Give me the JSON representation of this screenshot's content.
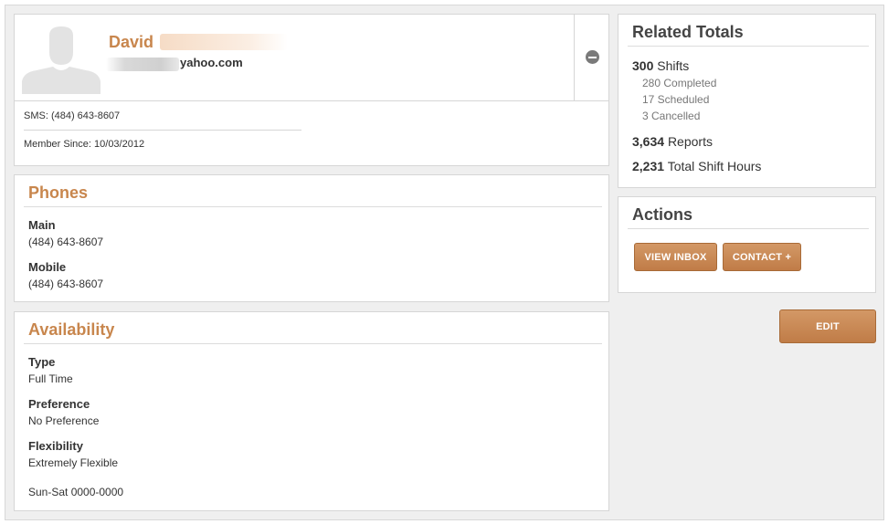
{
  "profile": {
    "first_name": "David",
    "email_visible": "yahoo.com",
    "sms": "SMS: (484) 643-8607",
    "member_since": "Member Since: 10/03/2012"
  },
  "phones": {
    "title": "Phones",
    "items": [
      {
        "label": "Main",
        "value": "(484) 643-8607"
      },
      {
        "label": "Mobile",
        "value": "(484) 643-8607"
      }
    ]
  },
  "availability": {
    "title": "Availability",
    "fields": [
      {
        "label": "Type",
        "value": "Full Time"
      },
      {
        "label": "Preference",
        "value": "No Preference"
      },
      {
        "label": "Flexibility",
        "value": "Extremely Flexible"
      }
    ],
    "schedule": "Sun-Sat 0000-0000"
  },
  "totals": {
    "title": "Related Totals",
    "shifts_count": "300",
    "shifts_label": "Shifts",
    "completed": "280 Completed",
    "scheduled": "17 Scheduled",
    "cancelled": "3 Cancelled",
    "reports_count": "3,634",
    "reports_label": "Reports",
    "hours_count": "2,231",
    "hours_label": "Total Shift Hours"
  },
  "actions": {
    "title": "Actions",
    "view_inbox": "VIEW INBOX",
    "contact": "CONTACT +",
    "edit": "EDIT"
  },
  "colors": {
    "accent": "#c8864d",
    "button": "#c88551",
    "background": "#efefef"
  },
  "icons": [
    "avatar-placeholder-icon",
    "remove-icon"
  ]
}
